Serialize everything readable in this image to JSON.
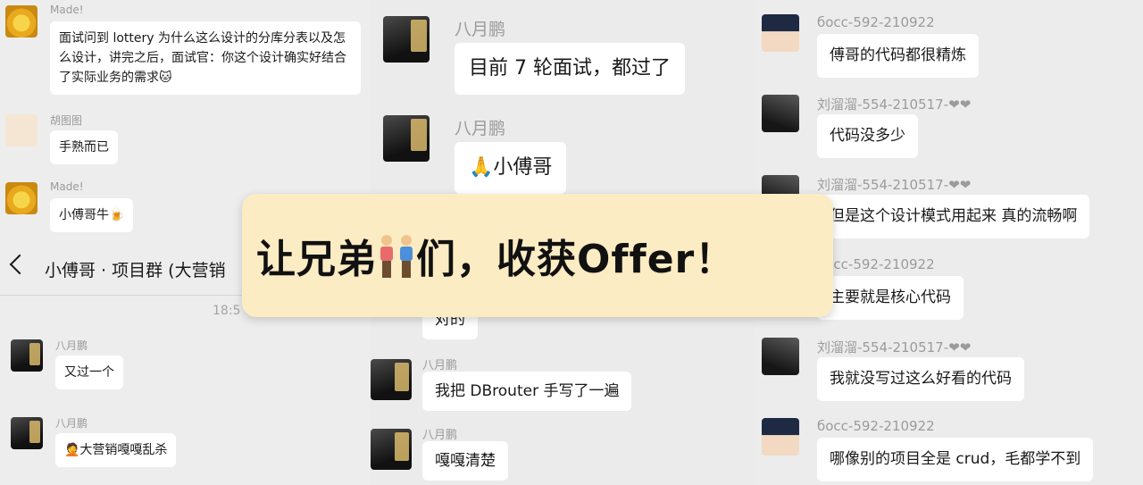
{
  "left_top_messages": [
    {
      "sender": "Made!",
      "text": "面试问到 lottery 为什么这么设计的分库分表以及怎么设计，讲完之后，面试官：你这个设计确实好结合了实际业务的需求🐱"
    },
    {
      "sender": "胡图图",
      "text": "手熟而已"
    },
    {
      "sender": "Made!",
      "text": "小傅哥牛🍺"
    }
  ],
  "group": {
    "title": "小傅哥 · 项目群 (大营销",
    "time": "18:5"
  },
  "left_bottom_messages": [
    {
      "sender": "八月鹏",
      "text": "又过一个"
    },
    {
      "sender": "八月鹏",
      "text": "🤦大营销嘎嘎乱杀"
    }
  ],
  "mid_messages": [
    {
      "sender": "八月鹏",
      "text": "目前 7 轮面试，都过了"
    },
    {
      "sender": "八月鹏",
      "text": "🙏小傅哥"
    },
    {
      "text": "对的"
    },
    {
      "sender": "八月鹏",
      "text": "我把 DBrouter 手写了一遍"
    },
    {
      "sender": "八月鹏",
      "text": "嘎嘎清楚"
    }
  ],
  "right_messages": [
    {
      "sender": "босс-592-210922",
      "text": "傅哥的代码都很精炼"
    },
    {
      "sender": "刘溜溜-554-210517-❤❤",
      "text": "代码没多少"
    },
    {
      "sender": "刘溜溜-554-210517-❤❤",
      "text": "但是这个设计模式用起来 真的流畅啊"
    },
    {
      "sender": "босс-592-210922",
      "text": "主要就是核心代码"
    },
    {
      "sender": "刘溜溜-554-210517-❤❤",
      "text": "我就没写过这么好看的代码"
    },
    {
      "sender": "босс-592-210922",
      "text": "哪像别的项目全是 crud，毛都学不到"
    }
  ],
  "banner": {
    "text_before": "让兄弟",
    "text_after": "们，收获Offer！"
  },
  "icons": {
    "back": "chevron-left-icon",
    "brothers": "two-men-icon"
  }
}
